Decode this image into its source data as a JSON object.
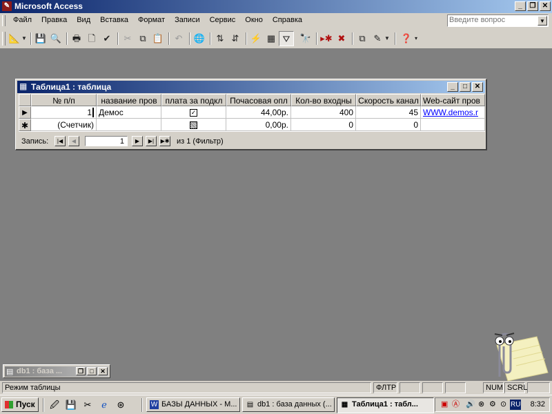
{
  "app": {
    "title": "Microsoft Access",
    "icon": "access-key-icon"
  },
  "menu": {
    "items": [
      "Файл",
      "Правка",
      "Вид",
      "Вставка",
      "Формат",
      "Записи",
      "Сервис",
      "Окно",
      "Справка"
    ],
    "help_placeholder": "Введите вопрос"
  },
  "table_window": {
    "title": "Таблица1 : таблица",
    "columns": [
      "№ п/п",
      "название пров",
      "плата за подкл",
      "Почасовая опл",
      "Кол-во входны",
      "Скорость канал",
      "Web-сайт пров"
    ],
    "row1": {
      "id": "1",
      "name": "Демос",
      "fee_checked": "✓",
      "hourly": "44,00р.",
      "lines": "400",
      "speed": "45",
      "web": "WWW.demos.r"
    },
    "new_row": {
      "id": "(Счетчик)",
      "name": "",
      "hourly": "0,00р.",
      "lines": "0",
      "speed": "0",
      "web": ""
    },
    "nav": {
      "label": "Запись:",
      "current": "1",
      "of_text": "из  1 (Фильтр)"
    }
  },
  "minimized": {
    "title": "db1 : база ..."
  },
  "status": {
    "mode": "Режим таблицы",
    "filter": "ФЛТР",
    "num": "NUM",
    "scrl": "SCRL"
  },
  "taskbar": {
    "start": "Пуск",
    "tasks": [
      "БАЗЫ ДАННЫХ - М...",
      "db1 : база данных (...",
      "Таблица1 : табл..."
    ],
    "lang": "RU",
    "clock": "8:32"
  },
  "colors": {
    "title_active_start": "#0a246a",
    "title_active_end": "#a6caf0",
    "face": "#d4d0c8",
    "workspace": "#808080",
    "link": "#0000ff"
  }
}
